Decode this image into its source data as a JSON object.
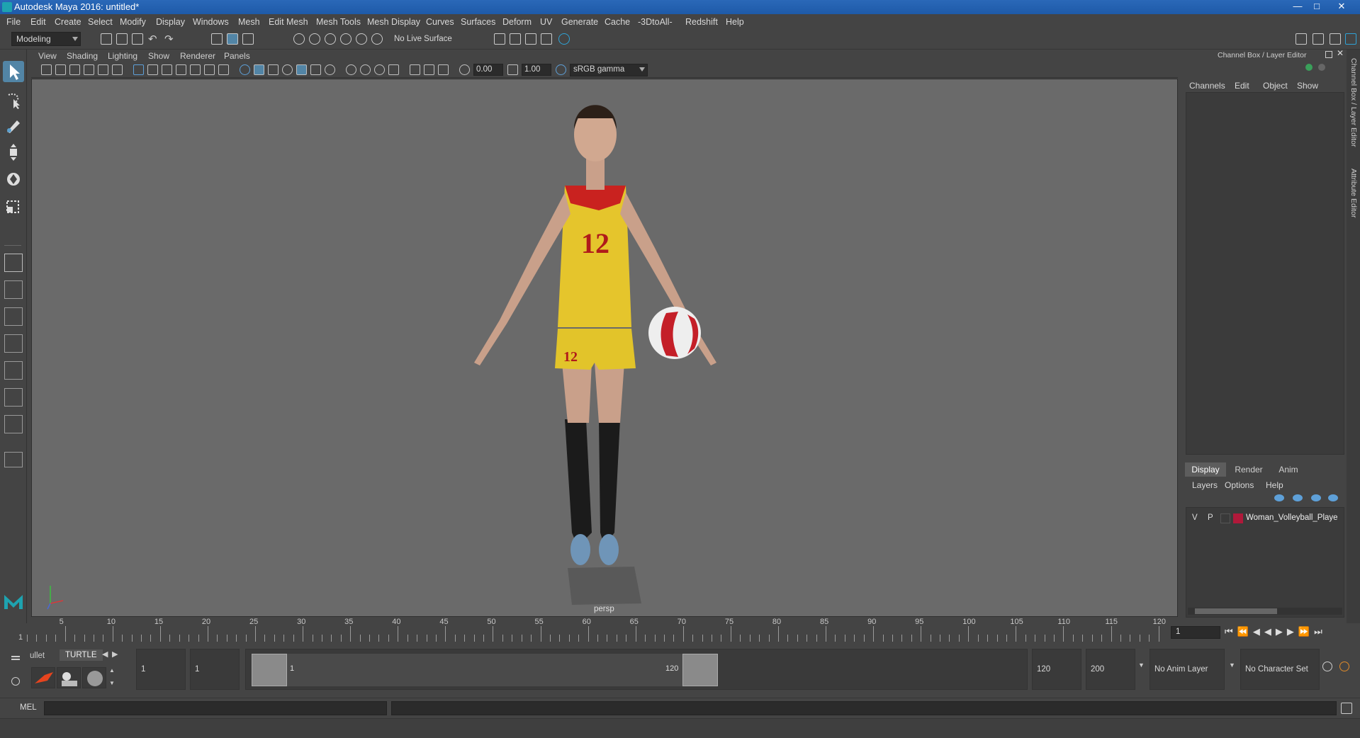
{
  "window": {
    "title": "Autodesk Maya 2016: untitled*"
  },
  "menu": [
    "File",
    "Edit",
    "Create",
    "Select",
    "Modify",
    "Display",
    "Windows",
    "Mesh",
    "Edit Mesh",
    "Mesh Tools",
    "Mesh Display",
    "Curves",
    "Surfaces",
    "Deform",
    "UV",
    "Generate",
    "Cache",
    "-3DtoAll-",
    "Redshift",
    "Help"
  ],
  "status": {
    "mode": "Modeling",
    "live_surface": "No Live Surface"
  },
  "panel_menu": [
    "View",
    "Shading",
    "Lighting",
    "Show",
    "Renderer",
    "Panels"
  ],
  "panel_toolbar": {
    "exposure": "0.00",
    "gamma": "1.00",
    "colorspace": "sRGB gamma"
  },
  "viewport": {
    "camera": "persp",
    "jersey_number": "12"
  },
  "channel_box": {
    "title": "Channel Box / Layer Editor",
    "menus": [
      "Channels",
      "Edit",
      "Object",
      "Show"
    ],
    "tabs": [
      "Display",
      "Render",
      "Anim"
    ],
    "active_tab": "Display",
    "layer_menus": [
      "Layers",
      "Options",
      "Help"
    ],
    "layer": {
      "v": "V",
      "p": "P",
      "name": "Woman_Volleyball_Playe",
      "color": "#b0193a"
    }
  },
  "side_tabs": [
    "Channel Box / Layer Editor",
    "Attribute Editor"
  ],
  "timeslider": {
    "ticks": [
      "5",
      "10",
      "15",
      "20",
      "25",
      "30",
      "35",
      "40",
      "45",
      "50",
      "55",
      "60",
      "65",
      "70",
      "75",
      "80",
      "85",
      "90",
      "95",
      "100",
      "105",
      "110",
      "115",
      "120"
    ],
    "start_label": "1",
    "current_frame": "1"
  },
  "shelf": {
    "tabs": [
      "ullet",
      "TURTLE"
    ]
  },
  "range": {
    "start": "1",
    "playback_start": "1",
    "range_start_label": "1",
    "range_end_label": "120",
    "playback_end": "120",
    "end": "200",
    "anim_layer": "No Anim Layer",
    "character_set": "No Character Set"
  },
  "cmdline": {
    "label": "MEL"
  },
  "colors": {
    "accent": "#5285a6",
    "titlebar": "#1e5aa8"
  }
}
